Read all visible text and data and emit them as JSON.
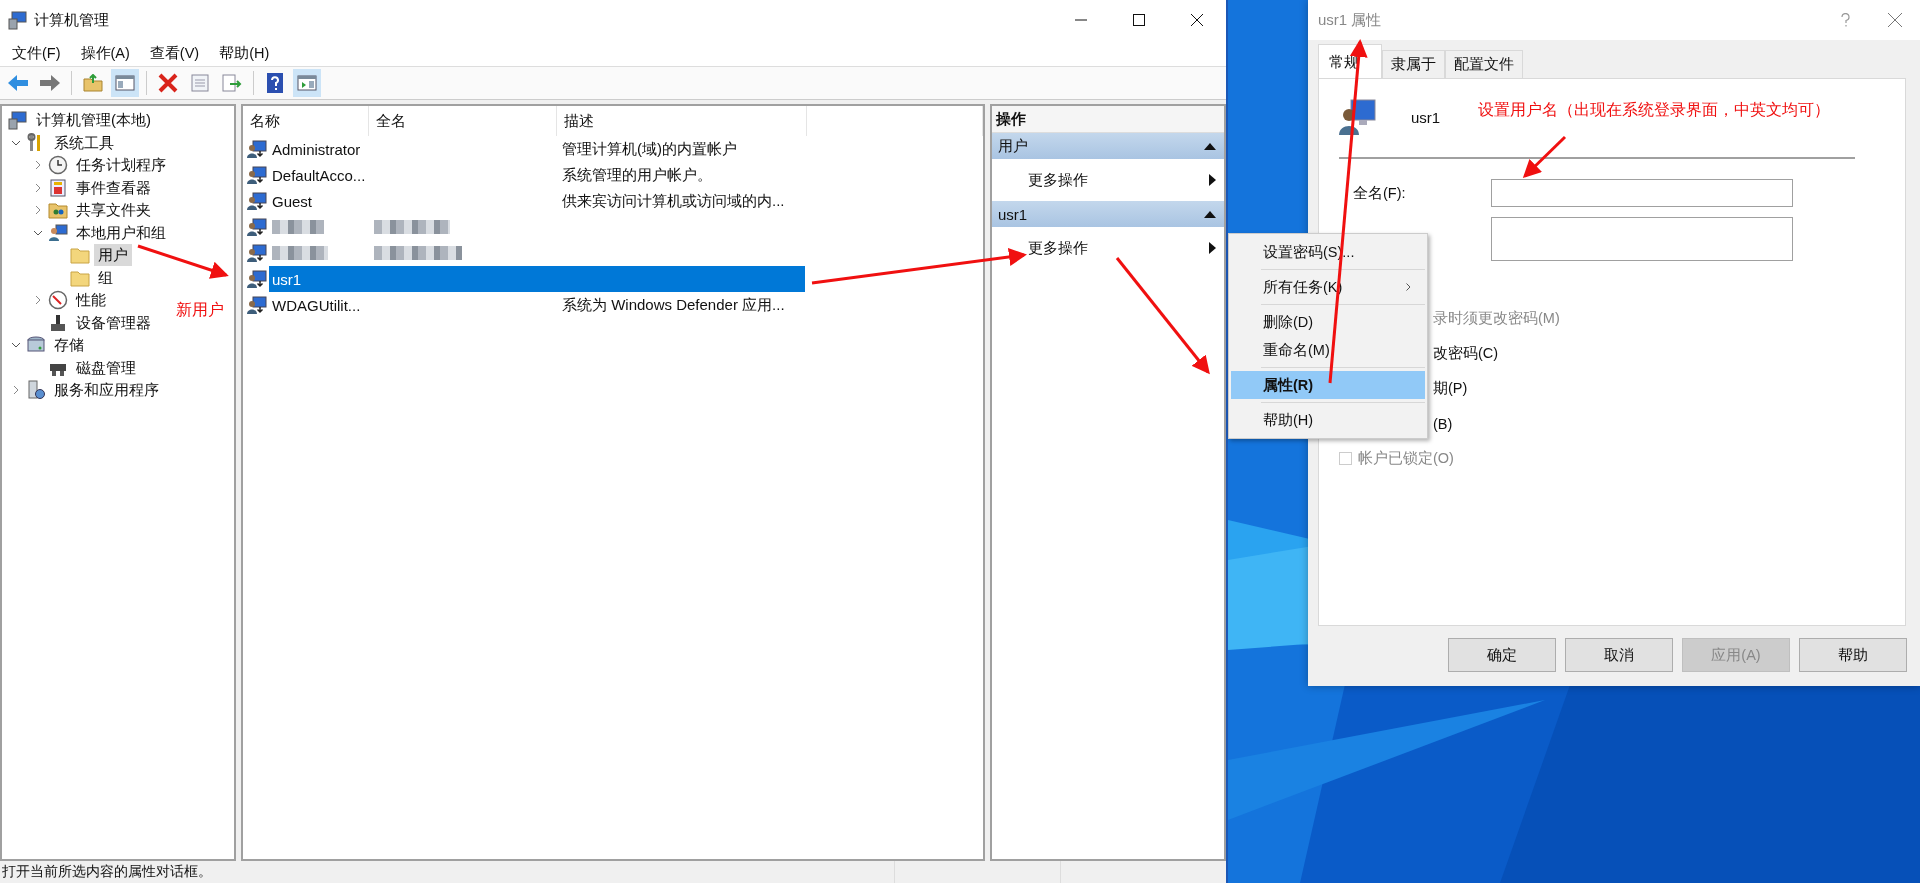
{
  "main_window": {
    "title": "计算机管理"
  },
  "menu": [
    "文件(F)",
    "操作(A)",
    "查看(V)",
    "帮助(H)"
  ],
  "toolbar": {
    "show_tree_pressed": true,
    "show_actions_pressed": true
  },
  "tree": [
    {
      "label": "计算机管理(本地)",
      "selected": false,
      "children": [
        {
          "label": "系统工具",
          "expanded": true,
          "selected": false,
          "children": [
            {
              "label": "任务计划程序",
              "expanded": false,
              "selected": false
            },
            {
              "label": "事件查看器",
              "expanded": false,
              "selected": false
            },
            {
              "label": "共享文件夹",
              "expanded": false,
              "selected": false
            },
            {
              "label": "本地用户和组",
              "expanded": true,
              "selected": false,
              "children": [
                {
                  "label": "用户",
                  "selected": true
                },
                {
                  "label": "组",
                  "selected": false
                }
              ]
            },
            {
              "label": "性能",
              "expanded": false,
              "selected": false
            },
            {
              "label": "设备管理器",
              "selected": false
            }
          ]
        },
        {
          "label": "存储",
          "expanded": true,
          "selected": false,
          "children": [
            {
              "label": "磁盘管理",
              "selected": false
            }
          ]
        },
        {
          "label": "服务和应用程序",
          "expanded": false,
          "selected": false
        }
      ]
    }
  ],
  "list": {
    "columns": [
      "名称",
      "全名",
      "描述"
    ],
    "rows": [
      {
        "kind": "user",
        "name": "Administrator",
        "description": "管理计算机(域)的内置帐户",
        "selected": false
      },
      {
        "kind": "user",
        "name": "DefaultAcco...",
        "description": "系统管理的用户帐户。",
        "selected": false
      },
      {
        "kind": "user",
        "name": "Guest",
        "description": "供来宾访问计算机或访问域的内...",
        "selected": false
      },
      {
        "kind": "redacted",
        "selected": false
      },
      {
        "kind": "redacted",
        "selected": false
      },
      {
        "kind": "user",
        "name": "usr1",
        "selected": true
      },
      {
        "kind": "user",
        "name": "WDAGUtilit...",
        "description": "系统为 Windows Defender 应用...",
        "selected": false
      }
    ]
  },
  "actions": {
    "title": "操作",
    "groups": [
      {
        "title": "用户",
        "expanded": true,
        "items": [
          "更多操作"
        ]
      },
      {
        "title": "usr1",
        "expanded": true,
        "items": [
          "更多操作"
        ]
      }
    ]
  },
  "status_bar": {
    "text": "打开当前所选内容的属性对话框。"
  },
  "context_menu": {
    "items": [
      {
        "kind": "item",
        "label": "设置密码(S)...",
        "selected": false
      },
      {
        "kind": "separator"
      },
      {
        "kind": "item",
        "label": "所有任务(K)",
        "submenu": true,
        "selected": false
      },
      {
        "kind": "separator"
      },
      {
        "kind": "item",
        "label": "删除(D)",
        "selected": false
      },
      {
        "kind": "item",
        "label": "重命名(M)",
        "selected": false
      },
      {
        "kind": "separator"
      },
      {
        "kind": "item",
        "label": "属性(R)",
        "selected": true
      },
      {
        "kind": "separator"
      },
      {
        "kind": "item",
        "label": "帮助(H)",
        "selected": false
      }
    ]
  },
  "dialog": {
    "title": "usr1 属性",
    "tabs": [
      {
        "label": "常规",
        "selected": true
      },
      {
        "label": "隶属于",
        "selected": false
      },
      {
        "label": "配置文件",
        "selected": false
      }
    ],
    "user_name": "usr1",
    "full_name_label": "全名(F):",
    "options": [
      {
        "kind": "partial",
        "label": "录时须更改密码(M)",
        "disabled": true
      },
      {
        "kind": "partial",
        "label": "改密码(C)",
        "disabled": false
      },
      {
        "kind": "partial",
        "label": "期(P)",
        "disabled": false
      },
      {
        "kind": "partial",
        "label": "(B)",
        "disabled": false
      },
      {
        "kind": "full",
        "label": "帐户已锁定(O)",
        "disabled": true,
        "checked": false
      }
    ],
    "buttons": [
      {
        "label": "确定",
        "disabled": false
      },
      {
        "label": "取消",
        "disabled": false
      },
      {
        "label": "应用(A)",
        "disabled": true
      },
      {
        "label": "帮助",
        "disabled": false
      }
    ]
  },
  "annotations": [
    {
      "text": "新用户"
    },
    {
      "text": "设置用户名（出现在系统登录界面，中英文均可）"
    }
  ]
}
